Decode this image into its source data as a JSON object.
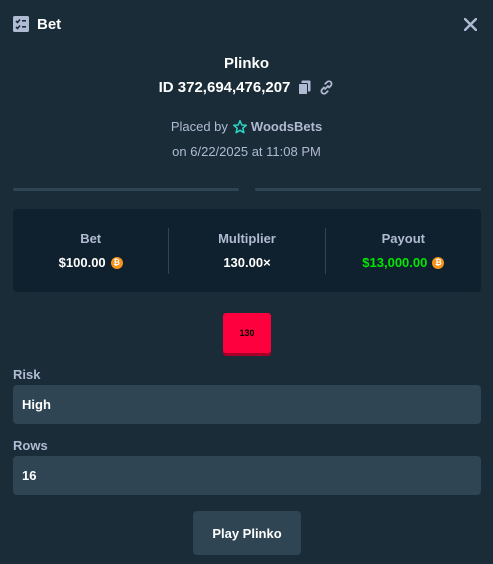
{
  "modal": {
    "title": "Bet",
    "icon": "bet-slip-icon",
    "close_icon": "close-icon"
  },
  "game": {
    "title": "Plinko",
    "bet_id": "ID 372,694,476,207",
    "placed_by_prefix": "Placed by",
    "username": "WoodsBets",
    "date_text": "on 6/22/2025 at 11:08 PM"
  },
  "stats": {
    "bet_label": "Bet",
    "bet_value": "$100.00",
    "multiplier_label": "Multiplier",
    "multiplier_value": "130.00×",
    "payout_label": "Payout",
    "payout_value": "$13,000.00",
    "currency_icon": "bitcoin-icon",
    "payout_color": "#00e701"
  },
  "result": {
    "value": "130",
    "color": "#ff003f"
  },
  "risk": {
    "label": "Risk",
    "value": "High"
  },
  "rows": {
    "label": "Rows",
    "value": "16"
  },
  "play_button": {
    "label": "Play Plinko"
  }
}
